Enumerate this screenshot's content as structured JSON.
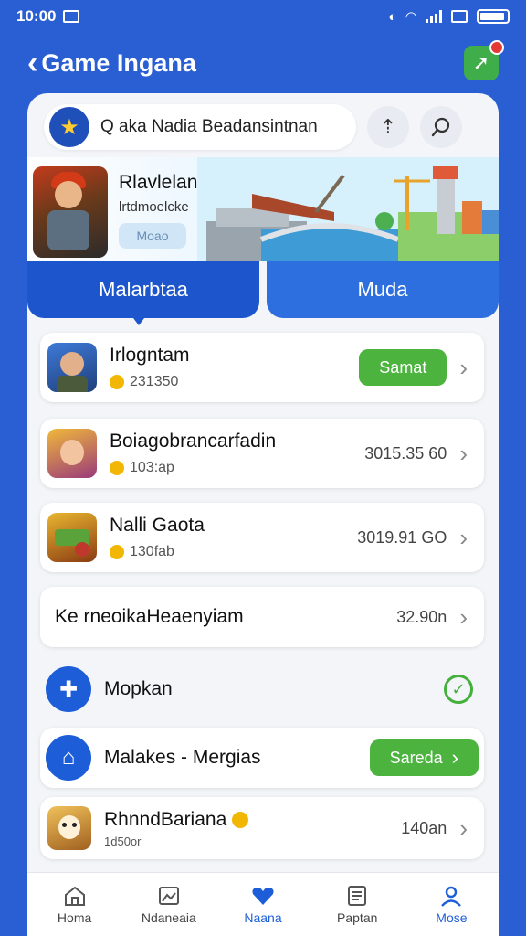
{
  "status_bar": {
    "time": "10:00"
  },
  "header": {
    "title": "Game Ingana"
  },
  "search": {
    "text": "Q aka Nadia Beadansintnan"
  },
  "banner": {
    "title": "Rlavlelan laah",
    "subtitle": "lrtdmoelcke",
    "pill_label": "Moao"
  },
  "tabs": [
    {
      "label": "Malarbtaa",
      "active": true
    },
    {
      "label": "Muda",
      "active": false
    }
  ],
  "list": [
    {
      "title": "Irlogntam",
      "sub": "231350",
      "action_label": "Samat"
    },
    {
      "title": "Boiagobrancarfadin",
      "sub": "103:ap",
      "value": "3015.35 60"
    },
    {
      "title": "Nalli Gaota",
      "sub": "130fab",
      "value": "3019.91 GO"
    },
    {
      "title": "Ke rneoikaHeaenyiam",
      "value": "32.90n"
    }
  ],
  "section": {
    "title": "Mopkan",
    "row_title": "Malakes -  Mergias",
    "row_button": "Sareda"
  },
  "last_item": {
    "title": "RhnndBariana",
    "sub": "1d50or",
    "value": "140an"
  },
  "nav": [
    {
      "label": "Homa",
      "icon": "home-icon"
    },
    {
      "label": "Ndaneaia",
      "icon": "gallery-icon"
    },
    {
      "label": "Naana",
      "icon": "heart-icon"
    },
    {
      "label": "Paptan",
      "icon": "document-icon"
    },
    {
      "label": "Mose",
      "icon": "profile-icon"
    }
  ],
  "colors": {
    "primary": "#2a5fd4",
    "accent_green": "#4cb33f",
    "card_bg": "#f3f5f9"
  }
}
